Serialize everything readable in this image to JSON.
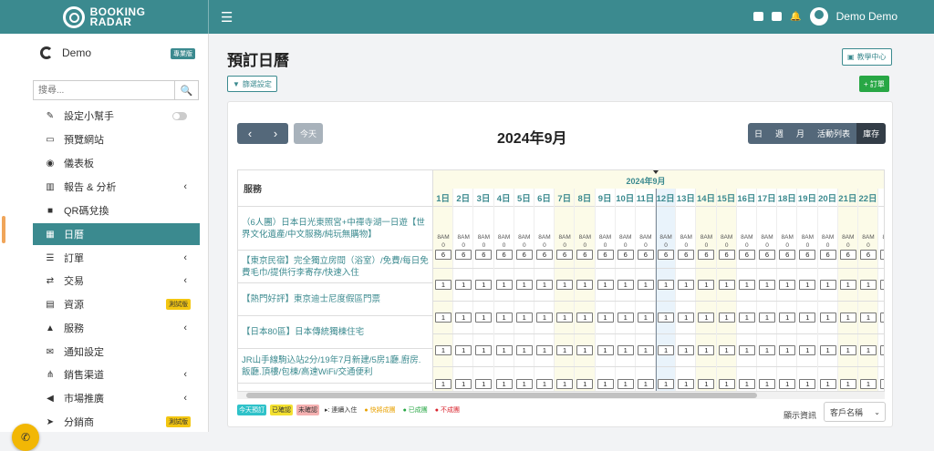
{
  "brand": {
    "line1": "BOOKING",
    "line2": "RADAR"
  },
  "topbar": {
    "menu_icon": "☰",
    "user_name": "Demo Demo"
  },
  "sidebar": {
    "account_name": "Demo",
    "plan_badge": "專業版",
    "search_placeholder": "搜尋...",
    "items": [
      {
        "label": "設定小幫手",
        "icon": "✎",
        "toggle": true
      },
      {
        "label": "預覽網站",
        "icon": "▭"
      },
      {
        "label": "儀表板",
        "icon": "◉"
      },
      {
        "label": "報告 & 分析",
        "icon": "▥",
        "chevron": true
      },
      {
        "label": "QR碼兌換",
        "icon": "■"
      },
      {
        "label": "日曆",
        "icon": "▦",
        "active": true
      },
      {
        "label": "訂單",
        "icon": "☰",
        "chevron": true
      },
      {
        "label": "交易",
        "icon": "⇄",
        "chevron": true
      },
      {
        "label": "資源",
        "icon": "▤",
        "badge": "測試版"
      },
      {
        "label": "服務",
        "icon": "▲",
        "chevron": true
      },
      {
        "label": "通知設定",
        "icon": "✉"
      },
      {
        "label": "銷售渠道",
        "icon": "⋔",
        "chevron": true
      },
      {
        "label": "市場推廣",
        "icon": "◀",
        "chevron": true
      },
      {
        "label": "分銷商",
        "icon": "➤",
        "badge": "測試版"
      }
    ]
  },
  "main": {
    "title": "預訂日曆",
    "help_label": "教學中心",
    "filter_label": "篩選設定",
    "order_label": "+ 訂單",
    "today_label": "今天",
    "month_title": "2024年9月",
    "views": [
      {
        "label": "日"
      },
      {
        "label": "週"
      },
      {
        "label": "月"
      },
      {
        "label": "活動列表"
      },
      {
        "label": "庫存",
        "active": true
      }
    ],
    "grid": {
      "service_header": "服務",
      "month_band": "2024年9月",
      "days": [
        "1日",
        "2日",
        "3日",
        "4日",
        "5日",
        "6日",
        "7日",
        "8日",
        "9日",
        "10日",
        "11日",
        "12日",
        "13日",
        "14日",
        "15日",
        "16日",
        "17日",
        "18日",
        "19日",
        "20日",
        "21日",
        "22日",
        "2"
      ],
      "weekend_days": [
        1,
        7,
        8,
        14,
        15,
        21,
        22
      ],
      "today_day": 12,
      "services": [
        {
          "name": "（6人團）日本日光東照宮+中禪寺湖一日遊【世界文化遺產/中文服務/純玩無購物】",
          "time": "8AM",
          "booked": "0",
          "avail": "6"
        },
        {
          "name": "【東京民宿】完全獨立房間（浴室）/免費/每日免費毛巾/提供行李寄存/快速入住",
          "avail": "1"
        },
        {
          "name": "【熱門好評】東京迪士尼度假區門票",
          "avail": "1"
        },
        {
          "name": "【日本80區】日本傳統獨棟住宅",
          "avail": "1"
        },
        {
          "name": "JR山手線駒込站2分/19年7月新建/5房1廳.廚房.飯廳.頂樓/包棟/高速WiFi/交通便利",
          "avail": "1"
        }
      ]
    },
    "legend": [
      {
        "label": "今天預訂",
        "bg": "#2fc2c9",
        "color": "#ffffff"
      },
      {
        "label": "已確認",
        "bg": "#f3e030",
        "color": "#333333"
      },
      {
        "label": "未確認",
        "bg": "#f5b1b1",
        "color": "#333333"
      },
      {
        "label": "▸: 連續入住",
        "bg": "",
        "color": "#333333"
      },
      {
        "label": "● 快將成團",
        "bg": "",
        "color": "#e8a100"
      },
      {
        "label": "● 已成團",
        "bg": "",
        "color": "#28a745"
      },
      {
        "label": "● 不成團",
        "bg": "",
        "color": "#d9232d"
      }
    ],
    "display_label": "顯示資訊",
    "display_value": "客戶名稱"
  }
}
